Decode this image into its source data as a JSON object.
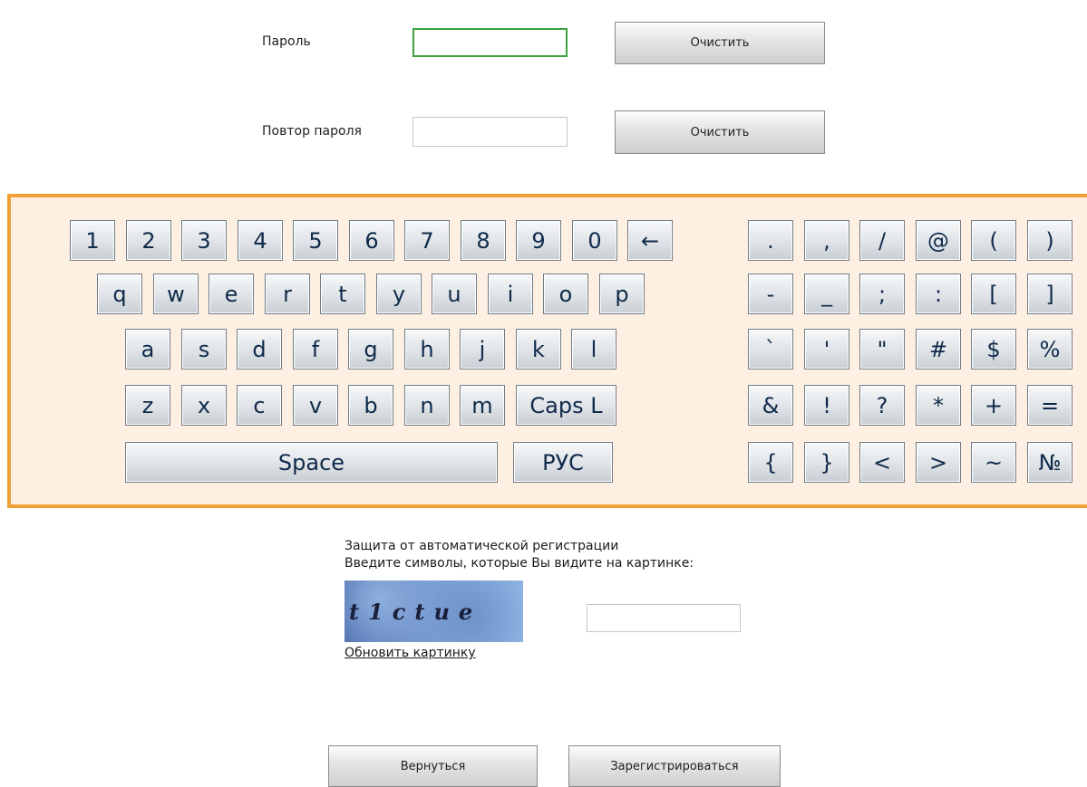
{
  "form": {
    "password_label": "Пароль",
    "password_value": "",
    "repeat_label": "Повтор пароля",
    "repeat_value": "",
    "clear_label": "Очистить"
  },
  "keyboard": {
    "left_rows": [
      [
        "1",
        "2",
        "3",
        "4",
        "5",
        "6",
        "7",
        "8",
        "9",
        "0",
        "←"
      ],
      [
        "q",
        "w",
        "e",
        "r",
        "t",
        "y",
        "u",
        "i",
        "o",
        "p"
      ],
      [
        "a",
        "s",
        "d",
        "f",
        "g",
        "h",
        "j",
        "k",
        "l"
      ],
      [
        "z",
        "x",
        "c",
        "v",
        "b",
        "n",
        "m",
        "Caps L"
      ],
      [
        "Space",
        "РУС"
      ]
    ],
    "right_rows": [
      [
        ".",
        ",",
        "/",
        "@",
        "(",
        ")"
      ],
      [
        "-",
        "_",
        ";",
        ":",
        "[",
        "]"
      ],
      [
        "`",
        "'",
        "\"",
        "#",
        "$",
        "%"
      ],
      [
        "&",
        "!",
        "?",
        "*",
        "+",
        "="
      ],
      [
        "{",
        "}",
        "<",
        ">",
        "~",
        "№"
      ]
    ],
    "accent_color": "#f0a036",
    "panel_bg": "#fdf0e2",
    "key_text_color": "#0f2a4a"
  },
  "captcha": {
    "line1": "Защита от автоматической регистрации",
    "line2": "Введите символы, которые Вы видите на картинке:",
    "image_text": "t1ctue",
    "refresh_label": "Обновить картинку",
    "input_value": ""
  },
  "footer": {
    "back_label": "Вернуться",
    "register_label": "Зарегистрироваться"
  }
}
